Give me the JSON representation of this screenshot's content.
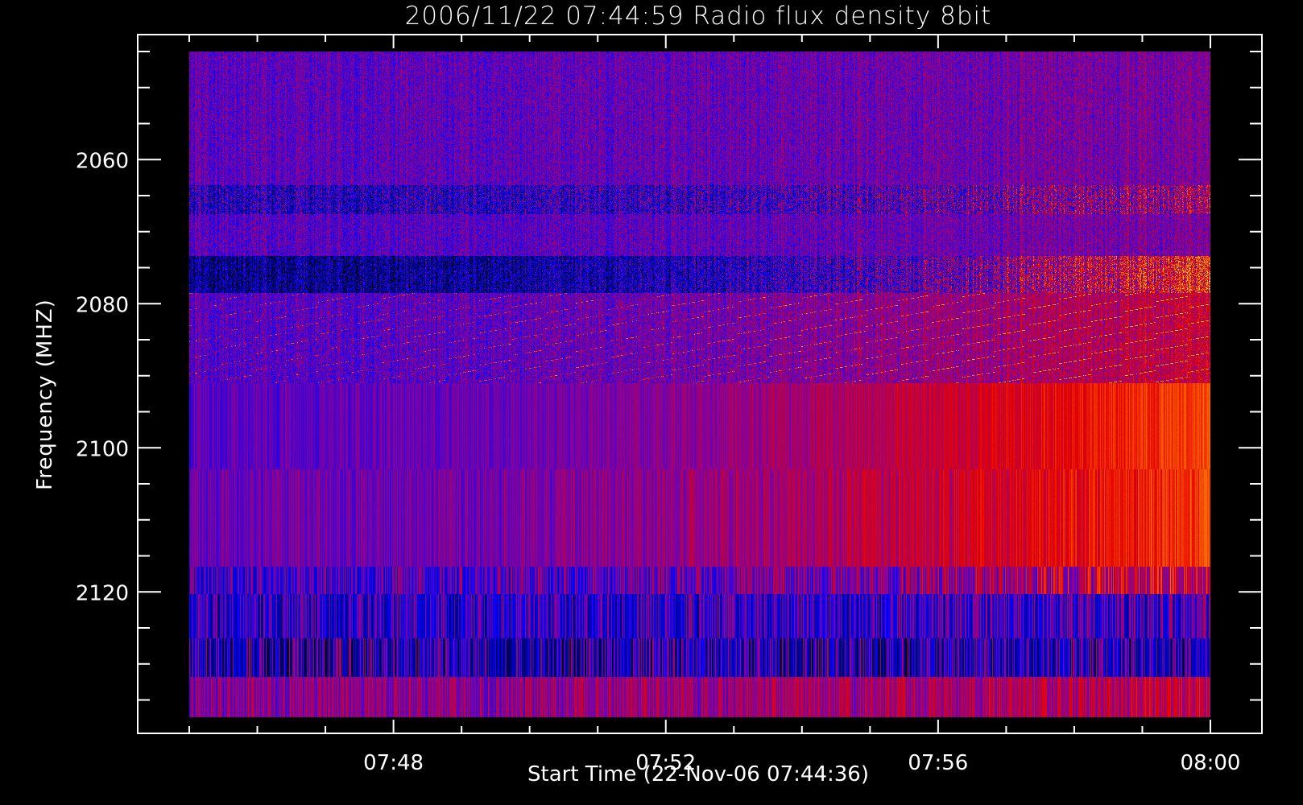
{
  "chart_data": {
    "type": "heatmap",
    "title": "2006/11/22 07:44:59 Radio flux density 8bit",
    "xlabel": "Start Time (22-Nov-06 07:44:36)",
    "ylabel": "Frequency (MHZ)",
    "x_unit": "minutes after 07:45",
    "xlim": [
      0,
      15
    ],
    "ylim": [
      2045,
      2137.4
    ],
    "y_inverted": true,
    "x_ticks": [
      {
        "value": 3,
        "label": "07:48"
      },
      {
        "value": 7,
        "label": "07:52"
      },
      {
        "value": 11,
        "label": "07:56"
      },
      {
        "value": 15,
        "label": "08:00"
      }
    ],
    "x_minor_step": 1,
    "y_ticks": [
      {
        "value": 2060,
        "label": "2060"
      },
      {
        "value": 2080,
        "label": "2080"
      },
      {
        "value": 2100,
        "label": "2100"
      },
      {
        "value": 2120,
        "label": "2120"
      }
    ],
    "y_minor_step": 5,
    "colormap": [
      "#000000",
      "#00008c",
      "#0000ff",
      "#8200a0",
      "#e60000",
      "#ff7800",
      "#ffff00"
    ],
    "bands": [
      {
        "f0": 2045.0,
        "f1": 2063.5,
        "mode": "noise",
        "base": 0.45,
        "trend": 0.05,
        "spread": 0.1
      },
      {
        "f0": 2063.5,
        "f1": 2067.6,
        "mode": "noise",
        "base": 0.32,
        "trend": 0.25,
        "spread": 0.22
      },
      {
        "f0": 2067.6,
        "f1": 2073.4,
        "mode": "noise",
        "base": 0.44,
        "trend": 0.06,
        "spread": 0.1
      },
      {
        "f0": 2073.4,
        "f1": 2078.5,
        "mode": "noise",
        "base": 0.18,
        "trend": 0.55,
        "spread": 0.22
      },
      {
        "f0": 2078.5,
        "f1": 2091.0,
        "mode": "drift",
        "base": 0.44,
        "trend": 0.18,
        "spread": 0.1
      },
      {
        "f0": 2091.0,
        "f1": 2103.0,
        "mode": "stripes",
        "base": 0.45,
        "trend": 0.32,
        "spread": 0.06
      },
      {
        "f0": 2103.0,
        "f1": 2116.5,
        "mode": "stripes",
        "base": 0.47,
        "trend": 0.28,
        "spread": 0.08
      },
      {
        "f0": 2116.5,
        "f1": 2120.3,
        "mode": "stripes",
        "base": 0.4,
        "trend": 0.25,
        "spread": 0.18
      },
      {
        "f0": 2120.3,
        "f1": 2126.4,
        "mode": "stripes",
        "base": 0.35,
        "trend": 0.05,
        "spread": 0.22
      },
      {
        "f0": 2126.4,
        "f1": 2131.8,
        "mode": "stripes",
        "base": 0.3,
        "trend": 0.02,
        "spread": 0.28
      },
      {
        "f0": 2131.8,
        "f1": 2137.4,
        "mode": "stripes",
        "base": 0.52,
        "trend": 0.08,
        "spread": 0.12
      }
    ]
  }
}
